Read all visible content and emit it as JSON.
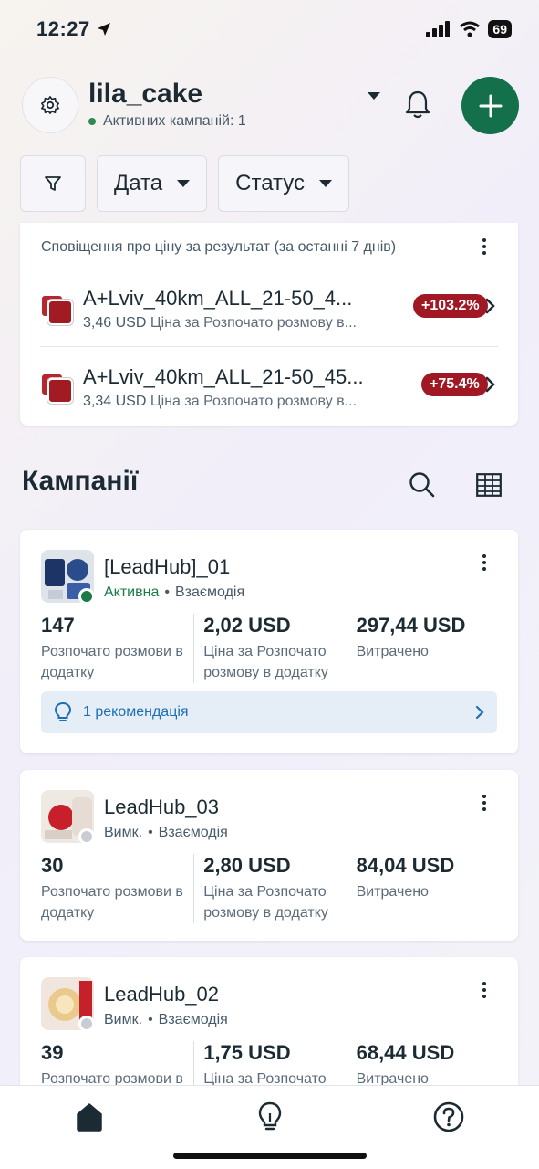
{
  "status_bar": {
    "time": "12:27",
    "battery": "69"
  },
  "header": {
    "account_name": "lila_cake",
    "active_campaigns": "Активних кампаній: 1",
    "icons": [
      "gear-icon",
      "chevron-down-icon",
      "bell-icon",
      "plus-icon"
    ]
  },
  "filters": {
    "date": "Дата",
    "status": "Статус"
  },
  "alerts": {
    "title": "Сповіщення про ціну за результат (за останні 7 днів)",
    "items": [
      {
        "name": "A+Lviv_40km_ALL_21-50_4...",
        "price": "3,46 USD",
        "desc": "Ціна за Розпочато розмову в...",
        "change": "+103.2%"
      },
      {
        "name": "A+Lviv_40km_ALL_21-50_45...",
        "price": "3,34 USD",
        "desc": "Ціна за Розпочато розмову в...",
        "change": "+75.4%"
      }
    ]
  },
  "campaigns_section": {
    "title": "Кампанії"
  },
  "campaigns": [
    {
      "name": "[LeadHub]_01",
      "status": "Активна",
      "type": "Взаємодія",
      "sep": "•",
      "metrics": [
        {
          "value": "147",
          "label": "Розпочато розмови в додатку"
        },
        {
          "value": "2,02 USD",
          "label": "Ціна за Розпочато розмову в додатку"
        },
        {
          "value": "297,44 USD",
          "label": "Витрачено"
        }
      ],
      "recommendation": "1 рекомендація",
      "status_color": "#1b7a45"
    },
    {
      "name": "LeadHub_03",
      "status": "Вимк.",
      "type": "Взаємодія",
      "sep": "•",
      "metrics": [
        {
          "value": "30",
          "label": "Розпочато розмови в додатку"
        },
        {
          "value": "2,80 USD",
          "label": "Ціна за Розпочато розмову в додатку"
        },
        {
          "value": "84,04 USD",
          "label": "Витрачено"
        }
      ],
      "status_color": "#c9cdd3"
    },
    {
      "name": "LeadHub_02",
      "status": "Вимк.",
      "type": "Взаємодія",
      "sep": "•",
      "metrics": [
        {
          "value": "39",
          "label": "Розпочато розмови в додатку"
        },
        {
          "value": "1,75 USD",
          "label": "Ціна за Розпочато розмову в додатку"
        },
        {
          "value": "68,44 USD",
          "label": "Витрачено"
        }
      ],
      "status_color": "#c9cdd3"
    }
  ],
  "bottom_nav": [
    "home-icon",
    "lightbulb-icon",
    "help-icon"
  ],
  "colors": {
    "brand_green": "#13704a",
    "alert_red": "#a01824",
    "link_blue": "#1e6fb3"
  }
}
